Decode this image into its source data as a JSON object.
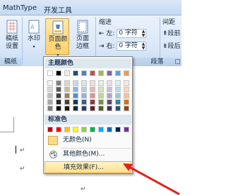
{
  "ribbon": {
    "tabs": [
      "MathType",
      "开发工具"
    ],
    "buttons": {
      "manuscript_line1": "稿纸",
      "manuscript_line2": "设置",
      "watermark": "水印",
      "page_color": "页面颜色",
      "page_border_line1": "页面",
      "page_border_line2": "边框"
    },
    "indent": {
      "heading": "缩进",
      "left_label": "左:",
      "left_value": "0 字符",
      "right_label": "右:",
      "right_value": "0 字符"
    },
    "spacing": {
      "heading": "间距",
      "before_label": "段前",
      "after_label": "段后"
    },
    "footers": {
      "manuscript": "稿纸",
      "paragraph": "段落"
    }
  },
  "dropdown": {
    "theme_colors_label": "主题颜色",
    "standard_colors_label": "标准色",
    "no_color": "无颜色(N)",
    "more_colors": "其他颜色(M)...",
    "fill_effects": "填充效果(F)..."
  },
  "colors": {
    "theme_top": [
      "#ffffff",
      "#000000",
      "#eeece1",
      "#1f497d",
      "#4f81bd",
      "#c0504d",
      "#9bbb59",
      "#8064a2",
      "#4bacc6",
      "#f79646"
    ],
    "theme_tints": [
      [
        "#f2f2f2",
        "#7f7f7f",
        "#ddd9c3",
        "#c6d9f0",
        "#dbe5f1",
        "#f2dcdb",
        "#ebf1dd",
        "#e5e0ec",
        "#dbeef3",
        "#fdeada"
      ],
      [
        "#d8d8d8",
        "#595959",
        "#c4bd97",
        "#8db3e2",
        "#b8cce4",
        "#e5b9b7",
        "#d7e3bc",
        "#ccc1d9",
        "#b7dde8",
        "#fbd5b5"
      ],
      [
        "#bfbfbf",
        "#3f3f3f",
        "#938953",
        "#548dd4",
        "#95b3d7",
        "#d99694",
        "#c3d69b",
        "#b2a2c7",
        "#92cddc",
        "#fac08f"
      ],
      [
        "#a5a5a5",
        "#262626",
        "#494429",
        "#17365d",
        "#366092",
        "#953734",
        "#76923c",
        "#5f497a",
        "#31859b",
        "#e36c09"
      ],
      [
        "#7f7f7f",
        "#0c0c0c",
        "#1d1b10",
        "#0f243e",
        "#244061",
        "#632423",
        "#4f6128",
        "#3f3151",
        "#205867",
        "#974806"
      ]
    ],
    "standard": [
      "#c00000",
      "#ff0000",
      "#ffc000",
      "#ffff00",
      "#92d050",
      "#00b050",
      "#00b0f0",
      "#0070c0",
      "#002060",
      "#7030a0"
    ],
    "arrow": "#e32119"
  }
}
